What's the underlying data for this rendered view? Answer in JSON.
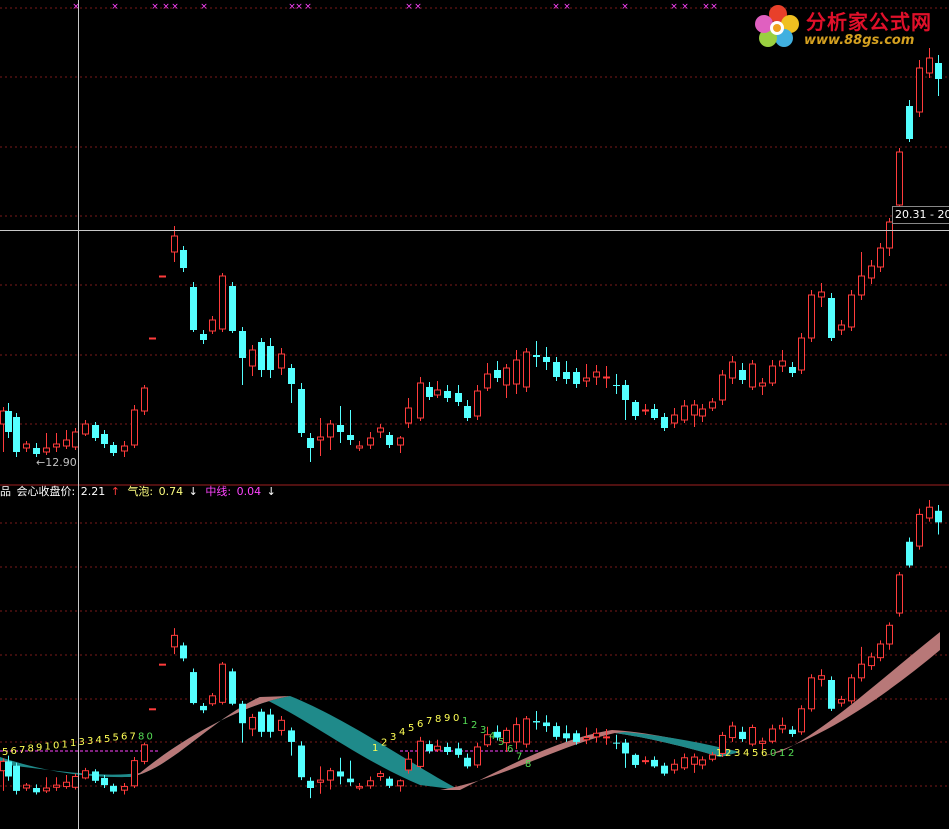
{
  "colors": {
    "background": "#000000",
    "up": "#ff3c3c",
    "down": "#54ffff",
    "grid": "#7a1a1a",
    "crosshair": "#c8c8c8",
    "band_up": "#b87878",
    "band_down": "#1f8a8a",
    "signal_x": "#ff44ff",
    "seq_yellow": "#ffff55",
    "seq_green": "#55dd55",
    "midline": "#ff44ff"
  },
  "logo": {
    "name": "分析家公式网",
    "url": "www.88gs.com",
    "icon": "flower-logo-icon"
  },
  "main_panel": {
    "crosshair_price_label": "20.31 - 20",
    "low_label": "←12.90"
  },
  "sub_panel": {
    "prefix": "品",
    "items": [
      {
        "label": "会心收盘价:",
        "value": "2.21",
        "arrow": "↑",
        "color": "#ffffff",
        "arrow_color": "#ff3c3c"
      },
      {
        "label": "气泡:",
        "value": "0.74",
        "arrow": "↓",
        "color": "#ffff80",
        "arrow_color": "#ffffff"
      },
      {
        "label": "中线:",
        "value": "0.04",
        "arrow": "↓",
        "color": "#ff44ff",
        "arrow_color": "#ffffff"
      }
    ]
  },
  "chart_data": {
    "type": "candlestick",
    "candles": [
      [
        3,
        424,
        411,
        407,
        452,
        0
      ],
      [
        8,
        411,
        432,
        403,
        438,
        1
      ],
      [
        16,
        417,
        452,
        413,
        457,
        1
      ],
      [
        26,
        448,
        444,
        441,
        452,
        0
      ],
      [
        36,
        448,
        454,
        443,
        457,
        1
      ],
      [
        46,
        448,
        452,
        433,
        455,
        0
      ],
      [
        56,
        447,
        444,
        433,
        452,
        0
      ],
      [
        66,
        446,
        440,
        430,
        449,
        0
      ],
      [
        75,
        447,
        432,
        428,
        450,
        0
      ],
      [
        85,
        434,
        424,
        420,
        436,
        0
      ],
      [
        95,
        425,
        438,
        422,
        441,
        1
      ],
      [
        104,
        434,
        444,
        430,
        448,
        1
      ],
      [
        113,
        445,
        453,
        442,
        456,
        1
      ],
      [
        124,
        446,
        451,
        441,
        457,
        0
      ],
      [
        134,
        445,
        410,
        405,
        448,
        0
      ],
      [
        144,
        411,
        388,
        385,
        415,
        0
      ],
      [
        162,
        276,
        276,
        276,
        276,
        0
      ],
      [
        152,
        338,
        338,
        338,
        338,
        0
      ],
      [
        174,
        252,
        236,
        226,
        262,
        0
      ],
      [
        183,
        250,
        268,
        246,
        272,
        1
      ],
      [
        193,
        287,
        330,
        282,
        332,
        1
      ],
      [
        203,
        334,
        340,
        330,
        344,
        1
      ],
      [
        212,
        331,
        320,
        316,
        334,
        0
      ],
      [
        222,
        329,
        276,
        273,
        332,
        0
      ],
      [
        232,
        286,
        331,
        282,
        333,
        1
      ],
      [
        242,
        331,
        358,
        327,
        385,
        1
      ],
      [
        252,
        366,
        350,
        345,
        376,
        0
      ],
      [
        261,
        342,
        370,
        338,
        377,
        1
      ],
      [
        270,
        346,
        370,
        338,
        378,
        1
      ],
      [
        281,
        368,
        354,
        348,
        375,
        0
      ],
      [
        291,
        368,
        384,
        364,
        403,
        1
      ],
      [
        301,
        389,
        433,
        383,
        437,
        1
      ],
      [
        310,
        438,
        448,
        433,
        462,
        1
      ],
      [
        320,
        437,
        440,
        418,
        456,
        0
      ],
      [
        330,
        437,
        424,
        420,
        450,
        0
      ],
      [
        340,
        425,
        432,
        406,
        443,
        1
      ],
      [
        350,
        435,
        440,
        410,
        445,
        1
      ],
      [
        359,
        446,
        448,
        441,
        451,
        0
      ],
      [
        370,
        445,
        438,
        432,
        449,
        0
      ],
      [
        380,
        432,
        428,
        424,
        438,
        0
      ],
      [
        389,
        435,
        445,
        432,
        448,
        1
      ],
      [
        400,
        445,
        438,
        436,
        453,
        0
      ],
      [
        408,
        423,
        408,
        398,
        428,
        0
      ],
      [
        420,
        418,
        383,
        377,
        421,
        0
      ],
      [
        429,
        387,
        397,
        382,
        400,
        1
      ],
      [
        437,
        395,
        390,
        381,
        398,
        0
      ],
      [
        447,
        391,
        398,
        385,
        402,
        1
      ],
      [
        458,
        393,
        402,
        385,
        406,
        1
      ],
      [
        467,
        406,
        418,
        400,
        421,
        1
      ],
      [
        477,
        416,
        391,
        385,
        420,
        0
      ],
      [
        487,
        388,
        374,
        363,
        391,
        0
      ],
      [
        497,
        378,
        370,
        361,
        382,
        1
      ],
      [
        506,
        385,
        368,
        364,
        398,
        0
      ],
      [
        516,
        384,
        360,
        350,
        394,
        0
      ],
      [
        526,
        387,
        352,
        348,
        392,
        0
      ],
      [
        536,
        355,
        357,
        341,
        367,
        1
      ],
      [
        546,
        357,
        362,
        347,
        370,
        1
      ],
      [
        556,
        362,
        377,
        357,
        381,
        1
      ],
      [
        566,
        372,
        379,
        361,
        384,
        1
      ],
      [
        576,
        372,
        384,
        368,
        388,
        1
      ],
      [
        586,
        381,
        378,
        364,
        387,
        0
      ],
      [
        596,
        377,
        372,
        365,
        385,
        0
      ],
      [
        606,
        378,
        377,
        366,
        388,
        0
      ],
      [
        616,
        385,
        386,
        374,
        394,
        1
      ],
      [
        625,
        385,
        400,
        380,
        420,
        1
      ],
      [
        635,
        402,
        416,
        400,
        420,
        1
      ],
      [
        645,
        410,
        410,
        404,
        415,
        0
      ],
      [
        654,
        409,
        418,
        404,
        420,
        1
      ],
      [
        664,
        417,
        428,
        413,
        431,
        1
      ],
      [
        674,
        423,
        415,
        408,
        428,
        0
      ],
      [
        684,
        420,
        406,
        400,
        423,
        0
      ],
      [
        694,
        415,
        405,
        400,
        427,
        0
      ],
      [
        702,
        416,
        409,
        404,
        422,
        0
      ],
      [
        712,
        408,
        402,
        398,
        411,
        0
      ],
      [
        722,
        400,
        375,
        370,
        405,
        0
      ],
      [
        732,
        378,
        362,
        356,
        384,
        0
      ],
      [
        742,
        370,
        380,
        363,
        384,
        1
      ],
      [
        752,
        387,
        364,
        360,
        390,
        0
      ],
      [
        762,
        386,
        383,
        378,
        395,
        0
      ],
      [
        772,
        383,
        366,
        360,
        386,
        0
      ],
      [
        782,
        366,
        361,
        350,
        372,
        0
      ],
      [
        792,
        373,
        367,
        362,
        377,
        1
      ],
      [
        801,
        370,
        338,
        333,
        374,
        0
      ],
      [
        811,
        338,
        295,
        290,
        342,
        0
      ],
      [
        821,
        297,
        292,
        283,
        307,
        0
      ],
      [
        831,
        298,
        338,
        293,
        341,
        1
      ],
      [
        841,
        330,
        325,
        320,
        335,
        0
      ],
      [
        851,
        327,
        295,
        290,
        331,
        0
      ],
      [
        861,
        295,
        276,
        252,
        300,
        0
      ],
      [
        871,
        278,
        266,
        260,
        284,
        0
      ],
      [
        880,
        267,
        248,
        243,
        272,
        0
      ],
      [
        889,
        248,
        222,
        218,
        256,
        0
      ],
      [
        899,
        205,
        152,
        148,
        210,
        0
      ],
      [
        909,
        106,
        139,
        100,
        142,
        1
      ],
      [
        919,
        112,
        68,
        60,
        117,
        0
      ],
      [
        929,
        73,
        58,
        48,
        78,
        0
      ],
      [
        938,
        63,
        79,
        55,
        96,
        1
      ]
    ],
    "signals_x": [
      76,
      115,
      155,
      166,
      175,
      204,
      292,
      299,
      308,
      409,
      418,
      556,
      567,
      625,
      674,
      685,
      706,
      714
    ],
    "seq_numbers_top": [
      "5",
      "6",
      "7",
      "8",
      "9",
      "1",
      "0",
      "1",
      "1",
      "3",
      "3",
      "4",
      "5",
      "5",
      "6",
      "7",
      "8",
      "0"
    ],
    "seq_numbers_mid": [
      "1",
      "2",
      "3",
      "4",
      "5",
      "6",
      "7",
      "8",
      "9",
      "0",
      "1",
      "2",
      "3",
      "4",
      "5",
      "6",
      "7",
      "8"
    ],
    "seq_numbers_right": [
      "1",
      "2",
      "3",
      "4",
      "5",
      "6",
      "0",
      "1",
      "2"
    ]
  }
}
